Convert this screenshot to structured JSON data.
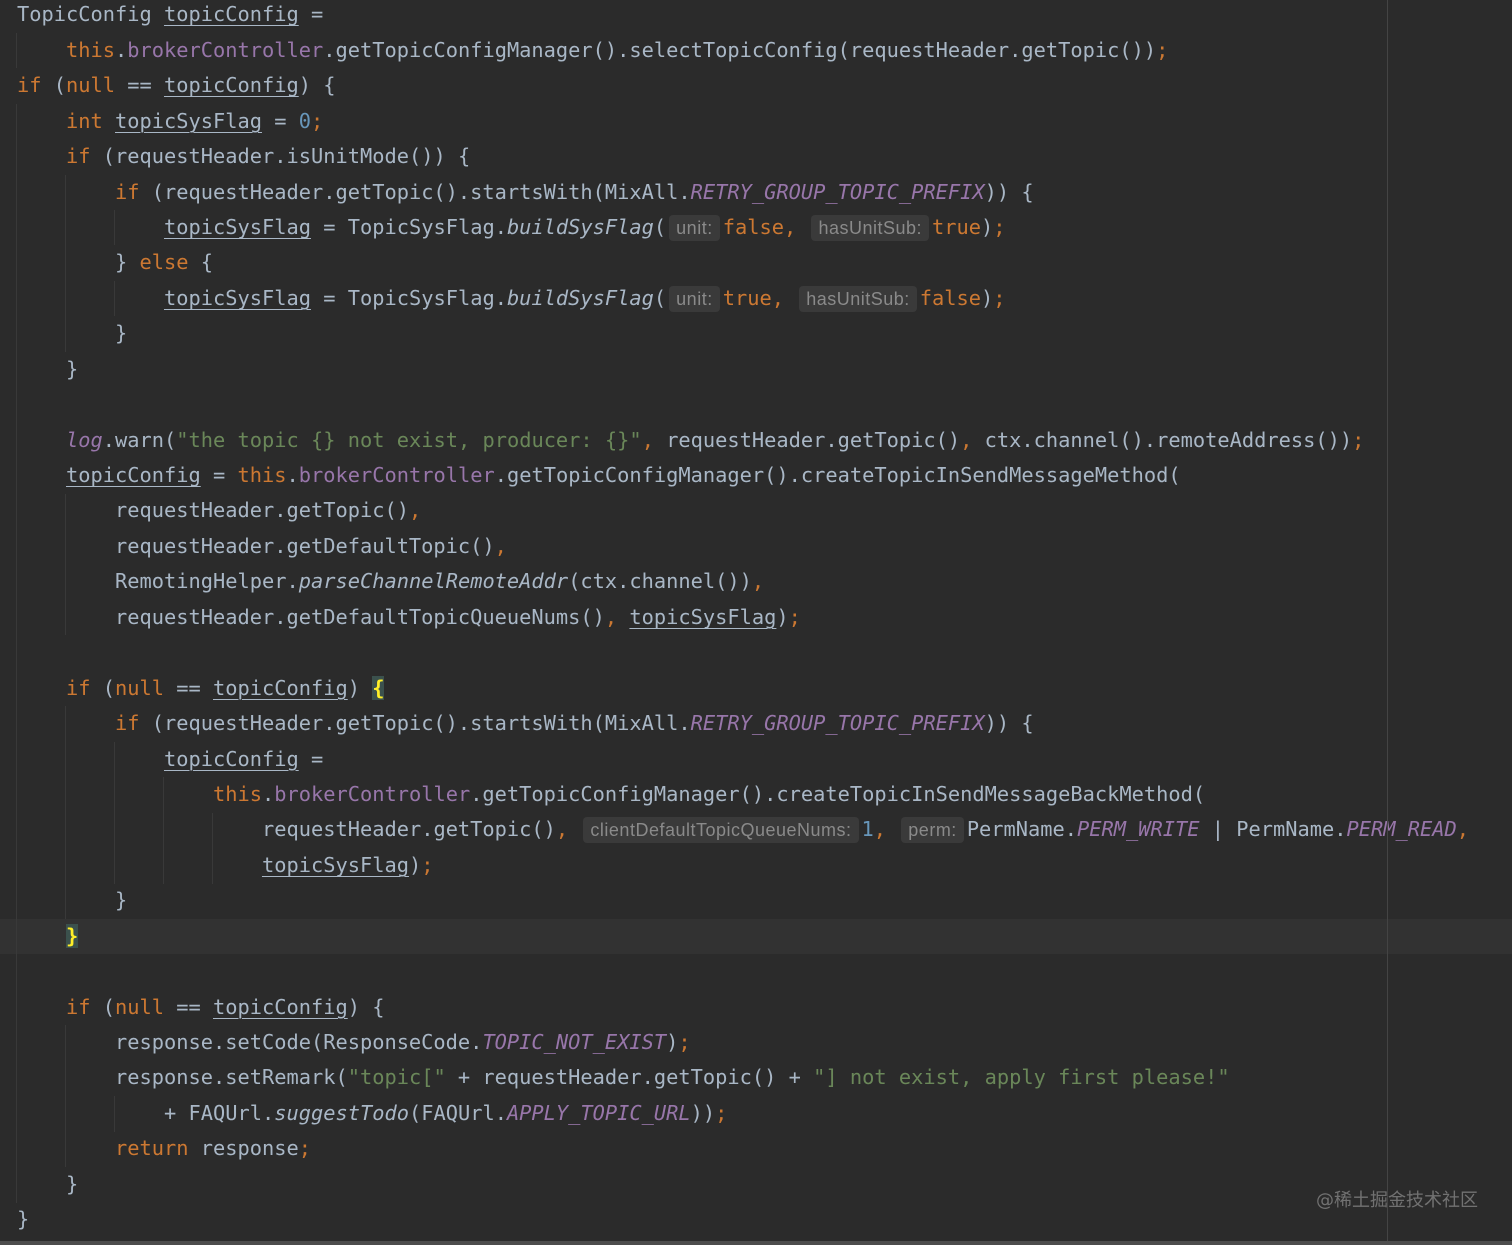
{
  "editor": {
    "background": "#2b2b2b",
    "current_line_background": "#323232",
    "lines": [
      {
        "tokens": [
          [
            "t",
            "TopicConfig "
          ],
          [
            "var",
            "topicConfig"
          ],
          [
            "t",
            " ="
          ]
        ]
      },
      {
        "tokens": [
          [
            "ws",
            "    "
          ],
          [
            "kw",
            "this"
          ],
          [
            "t",
            "."
          ],
          [
            "fld",
            "brokerController"
          ],
          [
            "t",
            ".getTopicConfigManager().selectTopicConfig(requestHeader.getTopic())"
          ],
          [
            "p",
            ";"
          ]
        ]
      },
      {
        "tokens": [
          [
            "kw",
            "if"
          ],
          [
            "t",
            " ("
          ],
          [
            "kw",
            "null"
          ],
          [
            "t",
            " == "
          ],
          [
            "var",
            "topicConfig"
          ],
          [
            "t",
            ") {"
          ]
        ]
      },
      {
        "tokens": [
          [
            "ws",
            "    "
          ],
          [
            "kw",
            "int"
          ],
          [
            "t",
            " "
          ],
          [
            "var",
            "topicSysFlag"
          ],
          [
            "t",
            " = "
          ],
          [
            "num",
            "0"
          ],
          [
            "p",
            ";"
          ]
        ]
      },
      {
        "tokens": [
          [
            "ws",
            "    "
          ],
          [
            "kw",
            "if"
          ],
          [
            "t",
            " (requestHeader.isUnitMode()) {"
          ]
        ]
      },
      {
        "tokens": [
          [
            "ws",
            "        "
          ],
          [
            "kw",
            "if"
          ],
          [
            "t",
            " (requestHeader.getTopic().startsWith(MixAll."
          ],
          [
            "cst",
            "RETRY_GROUP_TOPIC_PREFIX"
          ],
          [
            "t",
            ")) {"
          ]
        ]
      },
      {
        "tokens": [
          [
            "ws",
            "            "
          ],
          [
            "var",
            "topicSysFlag"
          ],
          [
            "t",
            " = TopicSysFlag."
          ],
          [
            "sm",
            "buildSysFlag"
          ],
          [
            "t",
            "("
          ],
          [
            "hint",
            "unit:"
          ],
          [
            "kw",
            "false"
          ],
          [
            "p",
            ", "
          ],
          [
            "hint",
            "hasUnitSub:"
          ],
          [
            "kw",
            "true"
          ],
          [
            "t",
            ")"
          ],
          [
            "p",
            ";"
          ]
        ]
      },
      {
        "tokens": [
          [
            "ws",
            "        "
          ],
          [
            "t",
            "} "
          ],
          [
            "kw",
            "else"
          ],
          [
            "t",
            " {"
          ]
        ]
      },
      {
        "tokens": [
          [
            "ws",
            "            "
          ],
          [
            "var",
            "topicSysFlag"
          ],
          [
            "t",
            " = TopicSysFlag."
          ],
          [
            "sm",
            "buildSysFlag"
          ],
          [
            "t",
            "("
          ],
          [
            "hint",
            "unit:"
          ],
          [
            "kw",
            "true"
          ],
          [
            "p",
            ", "
          ],
          [
            "hint",
            "hasUnitSub:"
          ],
          [
            "kw",
            "false"
          ],
          [
            "t",
            ")"
          ],
          [
            "p",
            ";"
          ]
        ]
      },
      {
        "tokens": [
          [
            "ws",
            "        "
          ],
          [
            "t",
            "}"
          ]
        ]
      },
      {
        "tokens": [
          [
            "ws",
            "    "
          ],
          [
            "t",
            "}"
          ]
        ]
      },
      {
        "tokens": []
      },
      {
        "tokens": [
          [
            "ws",
            "    "
          ],
          [
            "sf",
            "log"
          ],
          [
            "t",
            ".warn("
          ],
          [
            "str",
            "\"the topic {} not exist, producer: {}\""
          ],
          [
            "p",
            ", "
          ],
          [
            "t",
            "requestHeader.getTopic()"
          ],
          [
            "p",
            ", "
          ],
          [
            "t",
            "ctx.channel().remoteAddress())"
          ],
          [
            "p",
            ";"
          ]
        ]
      },
      {
        "tokens": [
          [
            "ws",
            "    "
          ],
          [
            "var",
            "topicConfig"
          ],
          [
            "t",
            " = "
          ],
          [
            "kw",
            "this"
          ],
          [
            "t",
            "."
          ],
          [
            "fld",
            "brokerController"
          ],
          [
            "t",
            ".getTopicConfigManager().createTopicInSendMessageMethod("
          ]
        ]
      },
      {
        "tokens": [
          [
            "ws",
            "        "
          ],
          [
            "t",
            "requestHeader.getTopic()"
          ],
          [
            "p",
            ","
          ]
        ]
      },
      {
        "tokens": [
          [
            "ws",
            "        "
          ],
          [
            "t",
            "requestHeader.getDefaultTopic()"
          ],
          [
            "p",
            ","
          ]
        ]
      },
      {
        "tokens": [
          [
            "ws",
            "        "
          ],
          [
            "t",
            "RemotingHelper."
          ],
          [
            "sm",
            "parseChannelRemoteAddr"
          ],
          [
            "t",
            "(ctx.channel())"
          ],
          [
            "p",
            ","
          ]
        ]
      },
      {
        "tokens": [
          [
            "ws",
            "        "
          ],
          [
            "t",
            "requestHeader.getDefaultTopicQueueNums()"
          ],
          [
            "p",
            ", "
          ],
          [
            "var",
            "topicSysFlag"
          ],
          [
            "t",
            ")"
          ],
          [
            "p",
            ";"
          ]
        ]
      },
      {
        "tokens": []
      },
      {
        "tokens": [
          [
            "ws",
            "    "
          ],
          [
            "kw",
            "if"
          ],
          [
            "t",
            " ("
          ],
          [
            "kw",
            "null"
          ],
          [
            "t",
            " == "
          ],
          [
            "var",
            "topicConfig"
          ],
          [
            "t",
            ") "
          ],
          [
            "brace",
            "{"
          ]
        ]
      },
      {
        "tokens": [
          [
            "ws",
            "        "
          ],
          [
            "kw",
            "if"
          ],
          [
            "t",
            " (requestHeader.getTopic().startsWith(MixAll."
          ],
          [
            "cst",
            "RETRY_GROUP_TOPIC_PREFIX"
          ],
          [
            "t",
            ")) {"
          ]
        ]
      },
      {
        "tokens": [
          [
            "ws",
            "            "
          ],
          [
            "var",
            "topicConfig"
          ],
          [
            "t",
            " ="
          ]
        ]
      },
      {
        "tokens": [
          [
            "ws",
            "                "
          ],
          [
            "kw",
            "this"
          ],
          [
            "t",
            "."
          ],
          [
            "fld",
            "brokerController"
          ],
          [
            "t",
            ".getTopicConfigManager().createTopicInSendMessageBackMethod("
          ]
        ]
      },
      {
        "tokens": [
          [
            "ws",
            "                    "
          ],
          [
            "t",
            "requestHeader.getTopic()"
          ],
          [
            "p",
            ", "
          ],
          [
            "hint",
            "clientDefaultTopicQueueNums:"
          ],
          [
            "num",
            "1"
          ],
          [
            "p",
            ", "
          ],
          [
            "hint",
            "perm:"
          ],
          [
            "t",
            "PermName."
          ],
          [
            "cst",
            "PERM_WRITE"
          ],
          [
            "t",
            " | PermName."
          ],
          [
            "cst",
            "PERM_READ"
          ],
          [
            "p",
            ","
          ]
        ]
      },
      {
        "tokens": [
          [
            "ws",
            "                    "
          ],
          [
            "var",
            "topicSysFlag"
          ],
          [
            "t",
            ")"
          ],
          [
            "p",
            ";"
          ]
        ]
      },
      {
        "tokens": [
          [
            "ws",
            "        "
          ],
          [
            "t",
            "}"
          ]
        ]
      },
      {
        "tokens": [
          [
            "ws",
            "    "
          ],
          [
            "brace",
            "}"
          ]
        ],
        "current": true
      },
      {
        "tokens": []
      },
      {
        "tokens": [
          [
            "ws",
            "    "
          ],
          [
            "kw",
            "if"
          ],
          [
            "t",
            " ("
          ],
          [
            "kw",
            "null"
          ],
          [
            "t",
            " == "
          ],
          [
            "var",
            "topicConfig"
          ],
          [
            "t",
            ") {"
          ]
        ]
      },
      {
        "tokens": [
          [
            "ws",
            "        "
          ],
          [
            "t",
            "response.setCode(ResponseCode."
          ],
          [
            "cst",
            "TOPIC_NOT_EXIST"
          ],
          [
            "t",
            ")"
          ],
          [
            "p",
            ";"
          ]
        ]
      },
      {
        "tokens": [
          [
            "ws",
            "        "
          ],
          [
            "t",
            "response.setRemark("
          ],
          [
            "str",
            "\"topic[\""
          ],
          [
            "t",
            " + requestHeader.getTopic() + "
          ],
          [
            "str",
            "\"] not exist, apply first please!\""
          ]
        ]
      },
      {
        "tokens": [
          [
            "ws",
            "            "
          ],
          [
            "t",
            "+ FAQUrl."
          ],
          [
            "sm",
            "suggestTodo"
          ],
          [
            "t",
            "(FAQUrl."
          ],
          [
            "cst",
            "APPLY_TOPIC_URL"
          ],
          [
            "t",
            "))"
          ],
          [
            "p",
            ";"
          ]
        ]
      },
      {
        "tokens": [
          [
            "ws",
            "        "
          ],
          [
            "kw",
            "return"
          ],
          [
            "t",
            " response"
          ],
          [
            "p",
            ";"
          ]
        ]
      },
      {
        "tokens": [
          [
            "ws",
            "    "
          ],
          [
            "t",
            "}"
          ]
        ]
      },
      {
        "tokens": [
          [
            "t",
            "}"
          ]
        ]
      }
    ]
  },
  "syntax_colors": {
    "t": "#a9b7c6",
    "kw": "#cc7832",
    "fld": "#9876aa",
    "cst": "#9876aa",
    "sf": "#9876aa",
    "sm": "#a9b7c6",
    "num": "#6897bb",
    "str": "#6a8759",
    "p": "#cc7832",
    "var": "#a9b7c6",
    "hint": "#8a8a8a",
    "brace": "#ffef28"
  },
  "watermark": "@稀土掘金技术社区"
}
